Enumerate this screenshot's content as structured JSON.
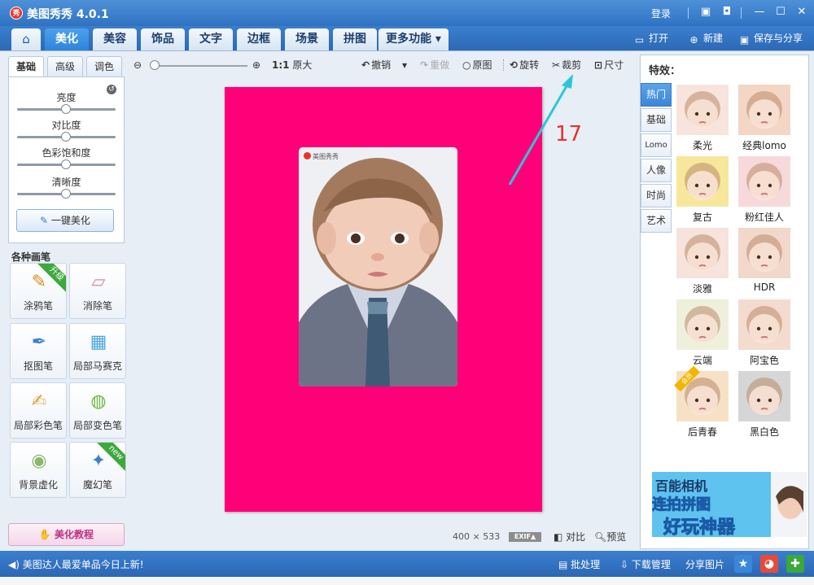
{
  "app": {
    "logo_text": "秀",
    "title": "美图秀秀 4.0.1",
    "login": "登录"
  },
  "main_tabs": [
    "美化",
    "美容",
    "饰品",
    "文字",
    "边框",
    "场景",
    "拼图",
    "更多功能"
  ],
  "top_actions": {
    "open": "打开",
    "new": "新建",
    "save_share": "保存与分享"
  },
  "left_panel": {
    "sub_tabs": [
      "基础",
      "高级",
      "调色"
    ],
    "sliders": [
      {
        "label": "亮度",
        "level": 0.5
      },
      {
        "label": "对比度",
        "level": 0.5
      },
      {
        "label": "色彩饱和度",
        "level": 0.5
      },
      {
        "label": "清晰度",
        "level": 0.5
      }
    ],
    "one_key": "一键美化",
    "brush_section": "各种画笔",
    "tools": [
      {
        "label": "涂鸦笔",
        "badge": "升级"
      },
      {
        "label": "消除笔",
        "badge": ""
      },
      {
        "label": "抠图笔",
        "badge": ""
      },
      {
        "label": "局部马赛克",
        "badge": ""
      },
      {
        "label": "局部彩色笔",
        "badge": ""
      },
      {
        "label": "局部变色笔",
        "badge": ""
      },
      {
        "label": "背景虚化",
        "badge": ""
      },
      {
        "label": "魔幻笔",
        "badge": "new"
      }
    ],
    "tutorial": "美化教程"
  },
  "center_toolbar": {
    "ratio": "1:1",
    "original_size": "原大",
    "undo": "撤销",
    "redo": "重做",
    "original": "原图",
    "rotate": "旋转",
    "crop": "裁剪",
    "resize": "尺寸"
  },
  "canvas": {
    "background": "#ff0078",
    "watermark": "美图秀秀"
  },
  "annotation_number": "17",
  "image_info": {
    "width": "400",
    "x": "×",
    "height": "533",
    "exif": "EXIF▲",
    "compare": "对比",
    "preview": "预览"
  },
  "right_panel": {
    "title": "特效：",
    "categories": [
      "热门",
      "基础",
      "Lomo",
      "人像",
      "时尚",
      "艺术"
    ],
    "effects": [
      {
        "label": "柔光",
        "tint": "#f7e4dc"
      },
      {
        "label": "经典lomo",
        "tint": "#f3d7c4"
      },
      {
        "label": "复古",
        "tint": "#f6e79c"
      },
      {
        "label": "粉红佳人",
        "tint": "#f7d9dc"
      },
      {
        "label": "淡雅",
        "tint": "#f6e3dc"
      },
      {
        "label": "HDR",
        "tint": "#f1d8cb"
      },
      {
        "label": "云端",
        "tint": "#eef0dc"
      },
      {
        "label": "阿宝色",
        "tint": "#f3dccf"
      },
      {
        "label": "后青春",
        "tint": "#f7e1c6",
        "badge": "会员"
      },
      {
        "label": "黑白色",
        "tint": "#d6d6d6"
      }
    ],
    "ad": {
      "line1": "百能相机",
      "line2": "连拍拼图",
      "line3": "好玩神器"
    }
  },
  "status_bar": {
    "message": "美图达人最爱单品今日上新!",
    "batch": "批处理",
    "download": "下载管理",
    "share": "分享图片"
  }
}
